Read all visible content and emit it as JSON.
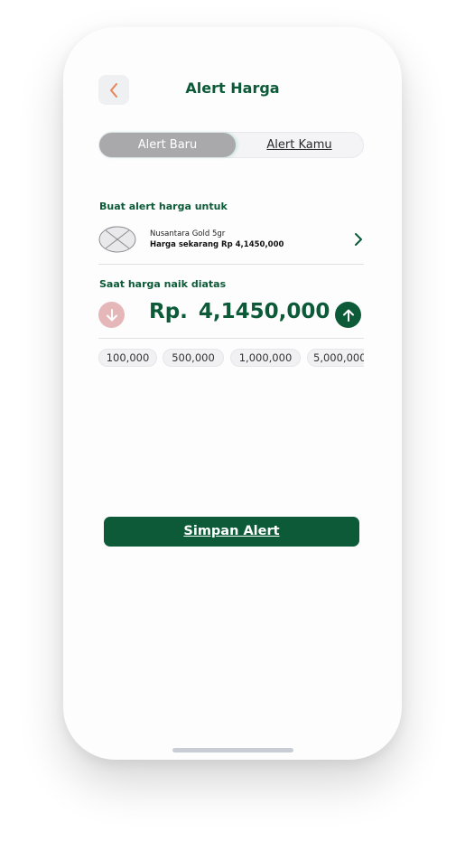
{
  "header": {
    "title": "Alert Harga",
    "back_icon": "chevron-left-icon"
  },
  "tabs": [
    {
      "label": "Alert Baru",
      "active": true
    },
    {
      "label": "Alert Kamu",
      "active": false
    }
  ],
  "section_product": {
    "label": "Buat alert harga untuk",
    "product_name": "Nusantara Gold 5gr",
    "product_price": "Harga sekarang Rp 4,1450,000"
  },
  "section_price": {
    "label": "Saat harga naik diatas",
    "currency": "Rp.",
    "amount": "4,1450,000"
  },
  "quick_amounts": [
    "100,000",
    "500,000",
    "1,000,000",
    "5,000,000"
  ],
  "save_button": {
    "label": "Simpan Alert"
  },
  "colors": {
    "primary": "#0c5a37",
    "back_accent": "#e8865a",
    "down_button": "#e6b7b9",
    "tab_active": "#a9a9ab"
  }
}
